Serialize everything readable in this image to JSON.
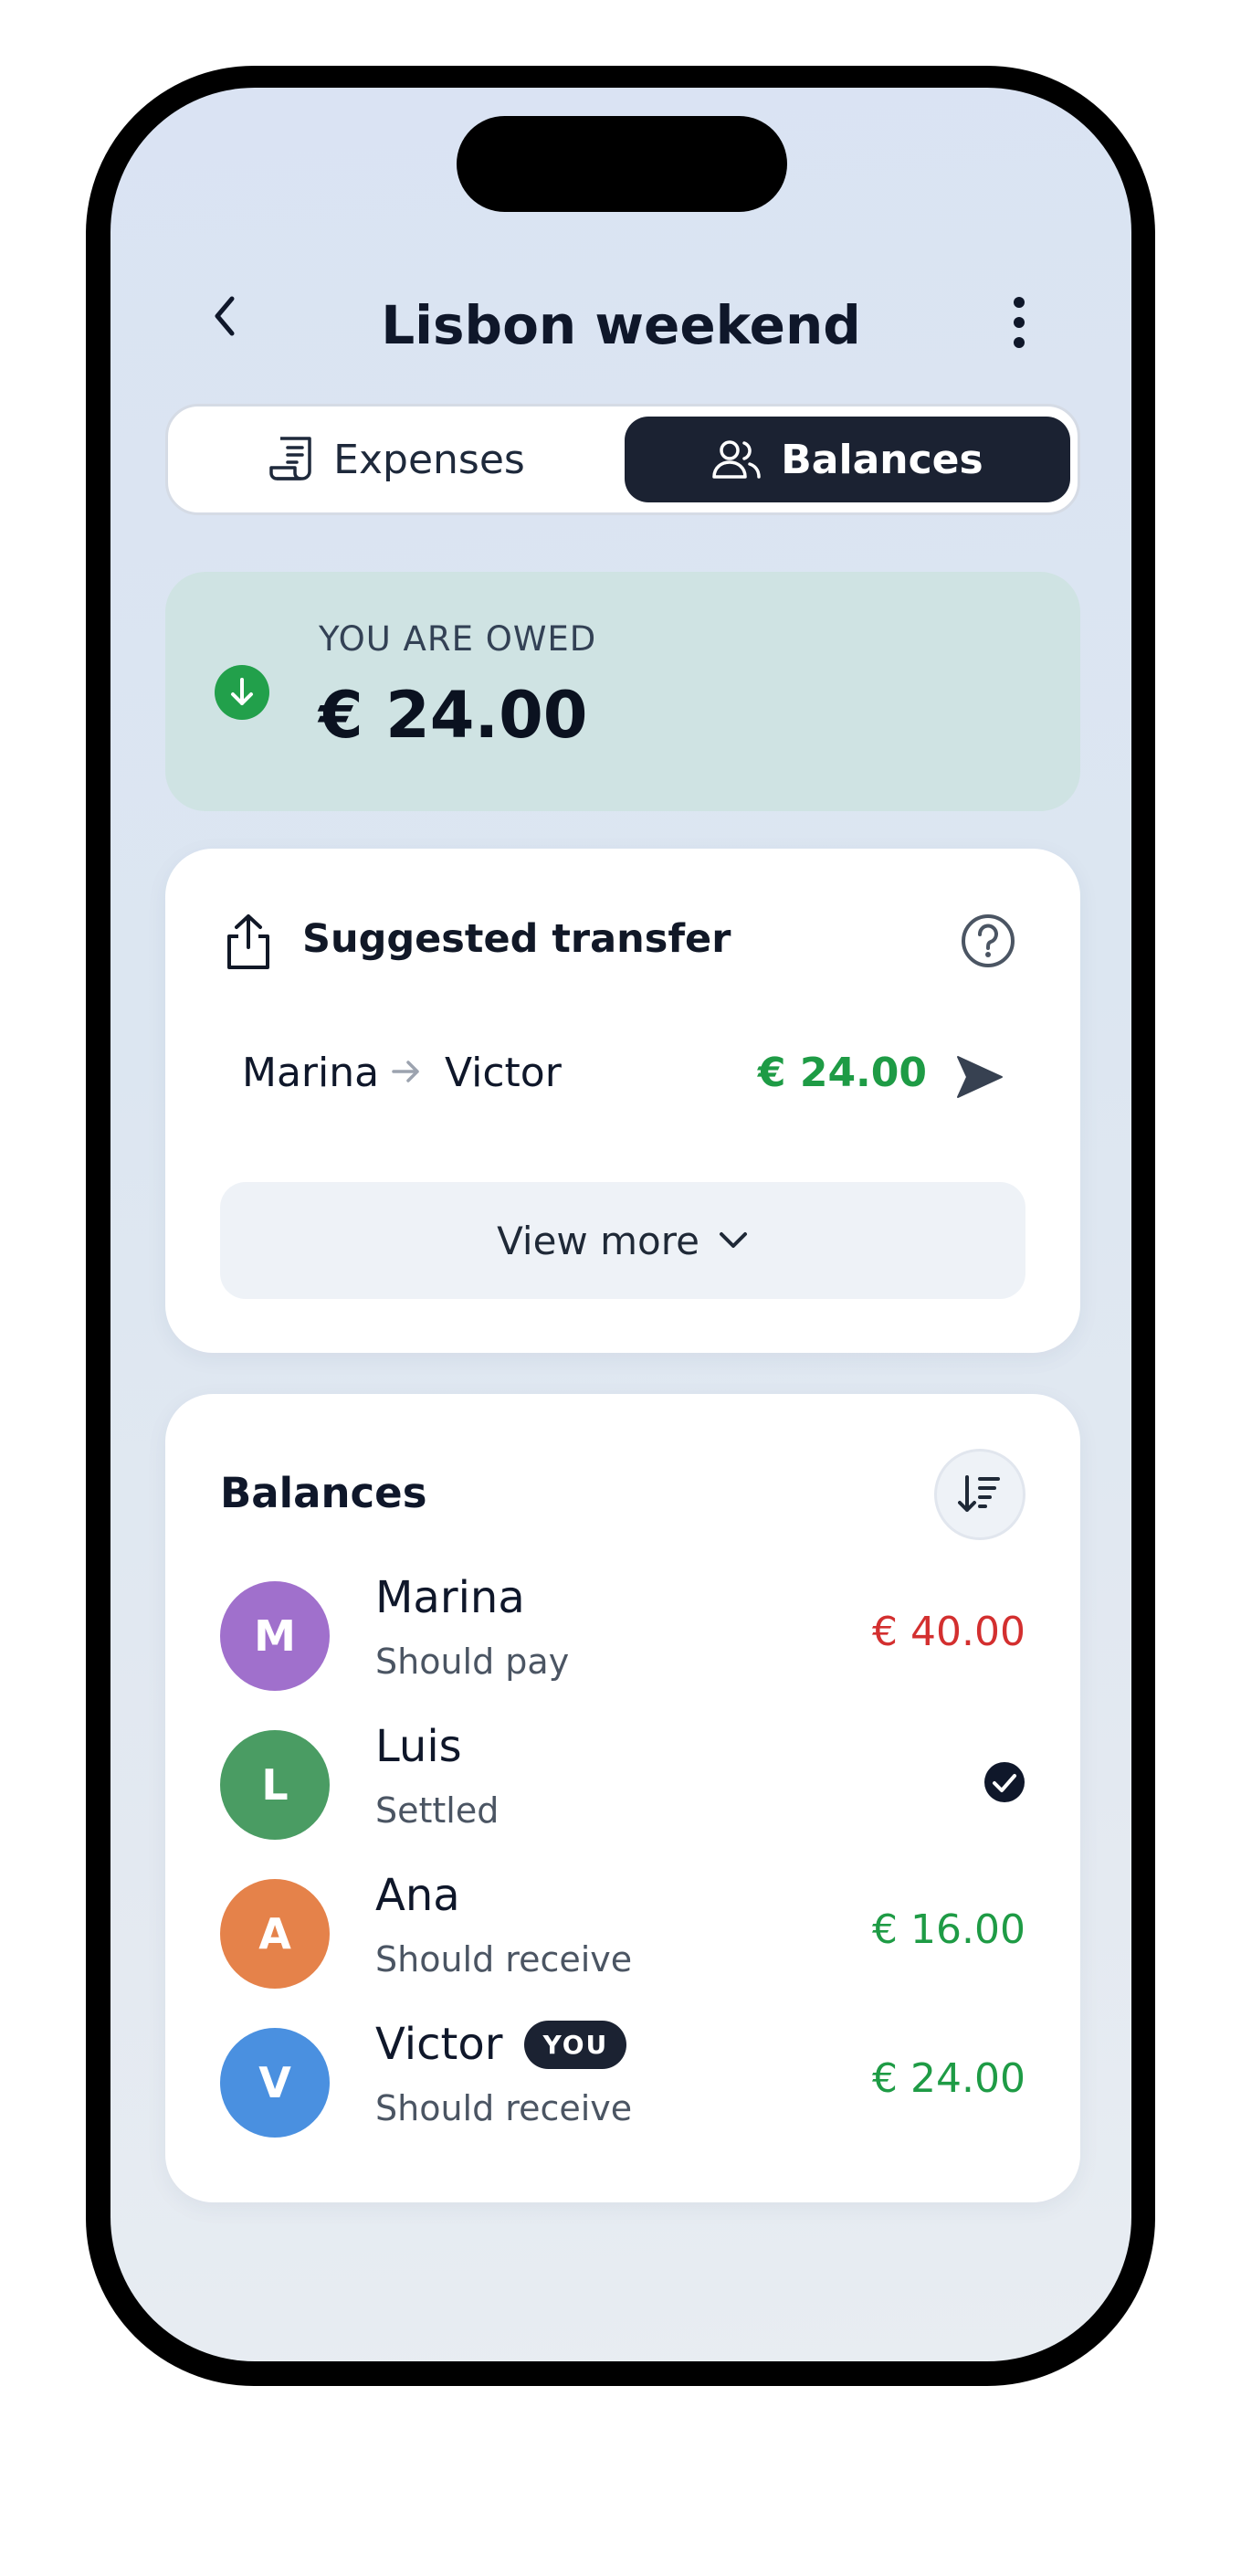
{
  "header": {
    "title": "Lisbon weekend"
  },
  "tabs": [
    {
      "label": "Expenses",
      "active": false
    },
    {
      "label": "Balances",
      "active": true
    }
  ],
  "summary": {
    "label": "YOU ARE OWED",
    "amount": "€ 24.00"
  },
  "transfer": {
    "title": "Suggested transfer",
    "from": "Marina",
    "to": "Victor",
    "amount": "€ 24.00",
    "view_more": "View more"
  },
  "balances": {
    "title": "Balances",
    "people": [
      {
        "initial": "M",
        "name": "Marina",
        "status": "Should pay",
        "amount": "€ 40.00",
        "avatar_color": "#a070cc",
        "amount_color": "#d32f2f"
      },
      {
        "initial": "L",
        "name": "Luis",
        "status": "Settled",
        "amount": "",
        "avatar_color": "#4a9c63",
        "amount_color": "#0f172a"
      },
      {
        "initial": "A",
        "name": "Ana",
        "status": "Should receive",
        "amount": "€ 16.00",
        "avatar_color": "#e5824a",
        "amount_color": "#1e9b45"
      },
      {
        "initial": "V",
        "name": "Victor",
        "badge": "YOU",
        "status": "Should receive",
        "amount": "€ 24.00",
        "avatar_color": "#4a90e0",
        "amount_color": "#1e9b45"
      }
    ]
  },
  "colors": {
    "accent_dark": "#1b2232",
    "positive": "#1e9b45",
    "negative": "#d32f2f"
  }
}
